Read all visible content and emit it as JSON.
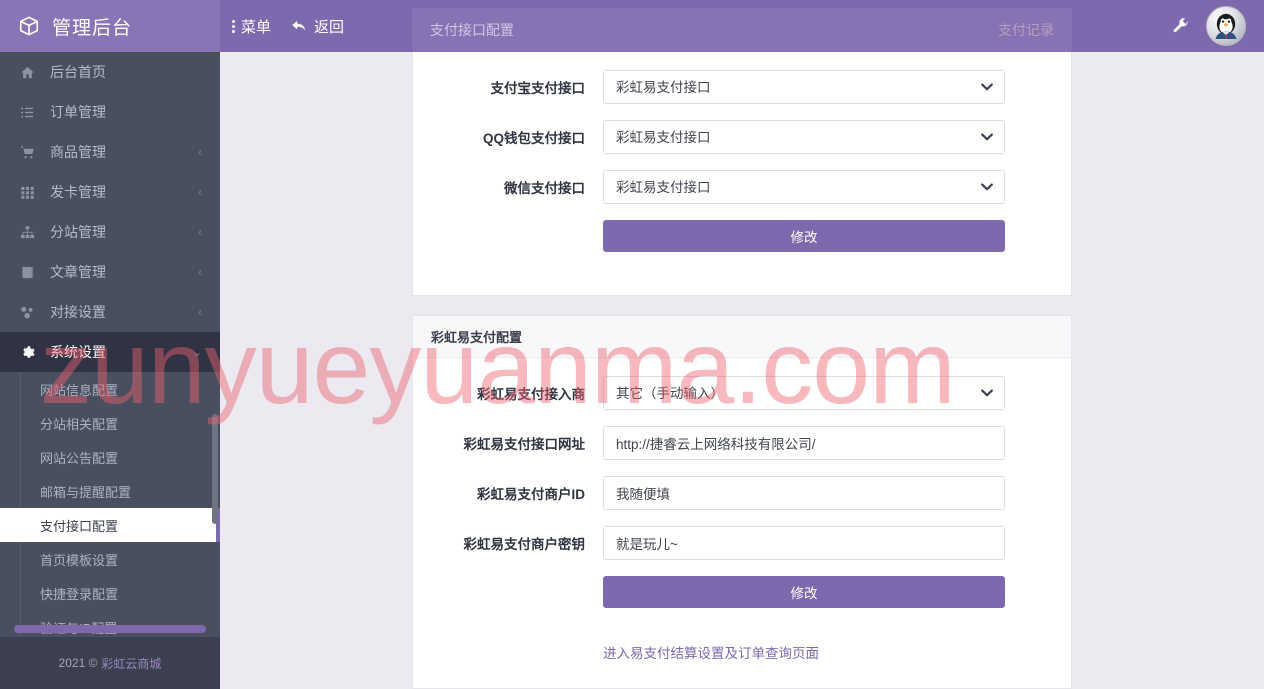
{
  "brand": {
    "title": "管理后台",
    "icon": "cube-icon"
  },
  "topbar": {
    "menu_label": "菜单",
    "back_label": "返回",
    "menu_icon": "dots-vertical-icon",
    "back_icon": "reply-arrow-icon",
    "wrench_icon": "wrench-icon",
    "avatar_icon": "qq-penguin-avatar",
    "tabs": [
      {
        "label": "支付接口配置",
        "active": true
      },
      {
        "label": "支付记录",
        "active": false
      }
    ]
  },
  "sidebar": {
    "items": [
      {
        "label": "后台首页",
        "icon": "home-icon",
        "caret": ""
      },
      {
        "label": "订单管理",
        "icon": "list-icon",
        "caret": ""
      },
      {
        "label": "商品管理",
        "icon": "cart-icon",
        "caret": "‹"
      },
      {
        "label": "发卡管理",
        "icon": "grid-icon",
        "caret": "‹"
      },
      {
        "label": "分站管理",
        "icon": "sitemap-icon",
        "caret": "‹"
      },
      {
        "label": "文章管理",
        "icon": "book-icon",
        "caret": "‹"
      },
      {
        "label": "对接设置",
        "icon": "plug-icon",
        "caret": "‹"
      },
      {
        "label": "系统设置",
        "icon": "gear-icon",
        "caret": "⌄"
      }
    ],
    "submenu": [
      {
        "label": "网站信息配置",
        "active": false
      },
      {
        "label": "分站相关配置",
        "active": false
      },
      {
        "label": "网站公告配置",
        "active": false
      },
      {
        "label": "邮箱与提醒配置",
        "active": false
      },
      {
        "label": "支付接口配置",
        "active": true
      },
      {
        "label": "首页模板设置",
        "active": false
      },
      {
        "label": "快捷登录配置",
        "active": false
      },
      {
        "label": "验证与IP配置",
        "active": false
      }
    ],
    "footer": {
      "copyright": "2021 ©",
      "site": "彩虹云商城"
    }
  },
  "card_interfaces": {
    "rows": [
      {
        "label": "支付宝支付接口",
        "value": "彩虹易支付接口"
      },
      {
        "label": "QQ钱包支付接口",
        "value": "彩虹易支付接口"
      },
      {
        "label": "微信支付接口",
        "value": "彩虹易支付接口"
      }
    ],
    "submit_label": "修改"
  },
  "card_epay": {
    "title": "彩虹易支付配置",
    "provider": {
      "label": "彩虹易支付接入商",
      "value": "其它（手动输入）"
    },
    "fields": [
      {
        "label": "彩虹易支付接口网址",
        "value": "http://捷睿云上网络科技有限公司/"
      },
      {
        "label": "彩虹易支付商户ID",
        "value": "我随便填"
      },
      {
        "label": "彩虹易支付商户密钥",
        "value": "就是玩儿~"
      }
    ],
    "submit_label": "修改",
    "footer_link": "进入易支付结算设置及订单查询页面"
  },
  "watermark": {
    "text": "zunyueyuanma.com"
  },
  "colors": {
    "brand_purple": "#7e68ae",
    "header_purple": "#8974b5",
    "sidebar_dark": "#4a4f60",
    "sidebar_active": "#2f3344",
    "content_bg": "#ece9f0",
    "watermark": "#ee626e"
  }
}
